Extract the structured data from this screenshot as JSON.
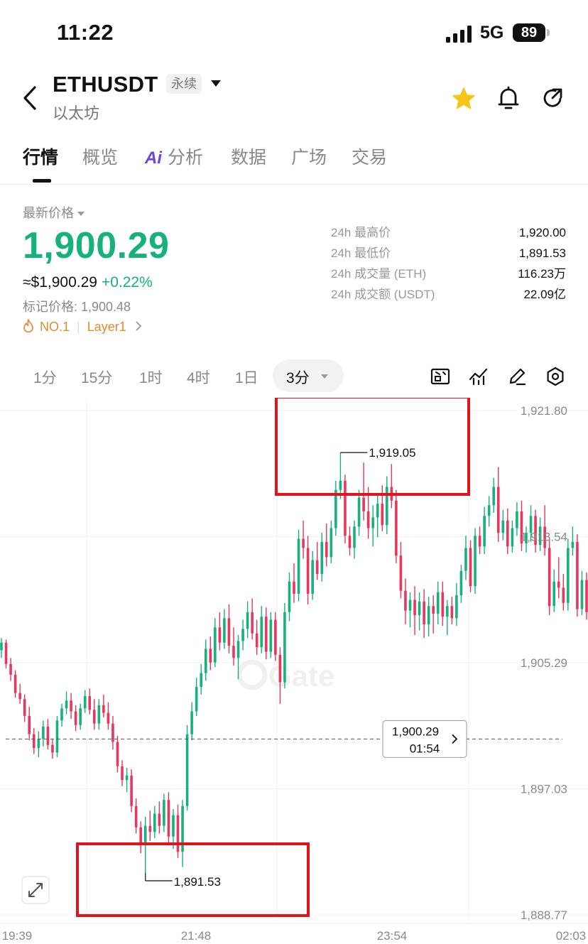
{
  "status_bar": {
    "time": "11:22",
    "network": "5G",
    "battery": "89"
  },
  "header": {
    "symbol": "ETHUSDT",
    "contract_type": "永续",
    "subtitle": "以太坊",
    "icons": [
      "back-icon",
      "star-icon",
      "bell-icon",
      "share-icon"
    ],
    "star_color": "#f5c518"
  },
  "tabs": [
    {
      "label": "行情",
      "active": true
    },
    {
      "label": "概览"
    },
    {
      "label": "分析",
      "prefix": "Ai"
    },
    {
      "label": "数据"
    },
    {
      "label": "广场"
    },
    {
      "label": "交易"
    }
  ],
  "price": {
    "latest_label": "最新价格",
    "last": "1,900.29",
    "usd": "≈$1,900.29",
    "change_pct": "+0.22%",
    "mark_price": "标记价格: 1,900.48",
    "rank": "NO.1",
    "sector": "Layer1",
    "up_color": "#16b27a",
    "down_color": "#e8365c"
  },
  "stats": [
    {
      "label": "24h 最高价",
      "value": "1,920.00"
    },
    {
      "label": "24h 最低价",
      "value": "1,891.53"
    },
    {
      "label": "24h 成交量 (ETH)",
      "value": "116.23万"
    },
    {
      "label": "24h 成交额 (USDT)",
      "value": "22.09亿"
    }
  ],
  "intervals": [
    "1分",
    "15分",
    "1时",
    "4时",
    "1日"
  ],
  "selected_interval": "3分",
  "chart_tools": [
    "indicator-icon",
    "compare-icon",
    "draw-icon",
    "settings-icon",
    "expand-icon"
  ],
  "chart_data": {
    "type": "candlestick",
    "watermark": "Gate",
    "y_ticks": [
      "1,921.80",
      "1,913.54",
      "1,905.29",
      "1,897.03",
      "1,888.77"
    ],
    "y_range": [
      1888.77,
      1921.8
    ],
    "x_ticks": [
      "19:39",
      "21:48",
      "23:54",
      "02:03"
    ],
    "high_label": "1,919.05",
    "low_label": "1,891.53",
    "current_price": "1,900.29",
    "current_countdown": "01:54",
    "highlight_color": "#e0141e",
    "candles": [
      [
        1906.1,
        1906.9,
        1905.6,
        1906.6
      ],
      [
        1906.6,
        1906.8,
        1904.9,
        1905.2
      ],
      [
        1905.2,
        1905.6,
        1904.1,
        1904.5
      ],
      [
        1904.5,
        1904.8,
        1903.0,
        1903.3
      ],
      [
        1903.3,
        1903.9,
        1902.6,
        1902.9
      ],
      [
        1902.9,
        1903.2,
        1901.4,
        1901.8
      ],
      [
        1901.8,
        1902.4,
        1900.2,
        1900.6
      ],
      [
        1900.6,
        1901.0,
        1899.3,
        1899.7
      ],
      [
        1899.7,
        1900.8,
        1899.1,
        1900.3
      ],
      [
        1900.3,
        1901.5,
        1899.8,
        1901.1
      ],
      [
        1901.1,
        1901.6,
        1899.6,
        1899.9
      ],
      [
        1899.9,
        1900.3,
        1899.0,
        1899.4
      ],
      [
        1899.4,
        1901.8,
        1899.1,
        1901.5
      ],
      [
        1901.5,
        1902.6,
        1901.1,
        1902.3
      ],
      [
        1902.3,
        1903.4,
        1901.9,
        1902.8
      ],
      [
        1902.8,
        1903.3,
        1901.6,
        1902.1
      ],
      [
        1902.1,
        1902.5,
        1900.8,
        1901.2
      ],
      [
        1901.2,
        1902.6,
        1900.9,
        1902.3
      ],
      [
        1902.3,
        1903.5,
        1902.0,
        1903.1
      ],
      [
        1903.1,
        1903.6,
        1901.9,
        1902.2
      ],
      [
        1902.2,
        1902.9,
        1900.9,
        1901.3
      ],
      [
        1901.3,
        1902.9,
        1900.9,
        1902.5
      ],
      [
        1902.5,
        1903.2,
        1901.7,
        1902.0
      ],
      [
        1902.0,
        1902.7,
        1900.9,
        1901.3
      ],
      [
        1901.3,
        1901.8,
        1899.6,
        1900.1
      ],
      [
        1900.1,
        1900.5,
        1898.1,
        1898.5
      ],
      [
        1898.5,
        1898.9,
        1897.2,
        1897.6
      ],
      [
        1897.6,
        1898.4,
        1896.8,
        1897.9
      ],
      [
        1897.9,
        1898.3,
        1895.5,
        1895.9
      ],
      [
        1895.9,
        1896.4,
        1894.1,
        1894.5
      ],
      [
        1894.5,
        1894.9,
        1892.8,
        1893.4
      ],
      [
        1893.4,
        1895.2,
        1891.53,
        1894.6
      ],
      [
        1894.6,
        1895.6,
        1893.6,
        1894.2
      ],
      [
        1894.2,
        1895.9,
        1893.8,
        1895.4
      ],
      [
        1895.4,
        1896.2,
        1894.1,
        1894.6
      ],
      [
        1894.6,
        1896.7,
        1894.2,
        1896.3
      ],
      [
        1896.3,
        1896.8,
        1893.5,
        1893.9
      ],
      [
        1893.9,
        1895.7,
        1893.1,
        1895.3
      ],
      [
        1895.3,
        1896.0,
        1892.5,
        1892.9
      ],
      [
        1892.9,
        1896.3,
        1891.9,
        1895.9
      ],
      [
        1895.9,
        1901.2,
        1895.6,
        1900.6
      ],
      [
        1900.6,
        1902.7,
        1900.2,
        1902.1
      ],
      [
        1902.1,
        1904.3,
        1901.8,
        1903.7
      ],
      [
        1903.7,
        1905.2,
        1903.2,
        1904.6
      ],
      [
        1904.6,
        1906.8,
        1904.1,
        1906.2
      ],
      [
        1906.2,
        1907.0,
        1904.8,
        1905.3
      ],
      [
        1905.3,
        1908.2,
        1905.0,
        1907.6
      ],
      [
        1907.6,
        1908.6,
        1906.1,
        1906.6
      ],
      [
        1906.6,
        1908.8,
        1906.2,
        1908.2
      ],
      [
        1908.2,
        1909.1,
        1905.9,
        1906.4
      ],
      [
        1906.4,
        1907.6,
        1905.1,
        1905.6
      ],
      [
        1905.6,
        1907.1,
        1904.2,
        1906.7
      ],
      [
        1906.7,
        1908.1,
        1906.1,
        1907.5
      ],
      [
        1907.5,
        1909.3,
        1906.9,
        1908.6
      ],
      [
        1908.6,
        1909.5,
        1906.8,
        1907.2
      ],
      [
        1907.2,
        1908.1,
        1905.8,
        1906.3
      ],
      [
        1906.3,
        1909.0,
        1905.9,
        1908.3
      ],
      [
        1908.3,
        1908.9,
        1905.5,
        1906.0
      ],
      [
        1906.0,
        1908.6,
        1905.6,
        1908.1
      ],
      [
        1908.1,
        1908.6,
        1905.4,
        1905.8
      ],
      [
        1905.8,
        1906.3,
        1902.6,
        1904.0
      ],
      [
        1904.0,
        1909.2,
        1903.6,
        1908.6
      ],
      [
        1908.6,
        1911.2,
        1908.0,
        1910.6
      ],
      [
        1910.6,
        1911.8,
        1909.2,
        1909.8
      ],
      [
        1909.8,
        1914.0,
        1909.3,
        1913.4
      ],
      [
        1913.4,
        1914.6,
        1912.1,
        1912.8
      ],
      [
        1912.8,
        1913.6,
        1909.1,
        1909.8
      ],
      [
        1909.8,
        1912.6,
        1909.4,
        1912.0
      ],
      [
        1912.0,
        1913.2,
        1910.7,
        1911.1
      ],
      [
        1911.1,
        1913.8,
        1910.6,
        1913.2
      ],
      [
        1913.2,
        1914.4,
        1911.6,
        1912.2
      ],
      [
        1912.2,
        1914.6,
        1911.8,
        1914.1
      ],
      [
        1914.1,
        1917.2,
        1913.6,
        1916.6
      ],
      [
        1916.6,
        1919.05,
        1916.0,
        1917.2
      ],
      [
        1917.2,
        1917.6,
        1913.1,
        1913.6
      ],
      [
        1913.6,
        1914.2,
        1912.3,
        1912.8
      ],
      [
        1912.8,
        1914.6,
        1912.1,
        1914.2
      ],
      [
        1914.2,
        1916.6,
        1913.6,
        1916.1
      ],
      [
        1916.1,
        1918.4,
        1914.6,
        1915.2
      ],
      [
        1915.2,
        1916.8,
        1913.4,
        1914.1
      ],
      [
        1914.1,
        1915.6,
        1912.9,
        1914.8
      ],
      [
        1914.8,
        1916.3,
        1913.5,
        1915.7
      ],
      [
        1915.7,
        1916.9,
        1913.9,
        1914.3
      ],
      [
        1914.3,
        1917.5,
        1913.7,
        1916.8
      ],
      [
        1916.8,
        1918.3,
        1915.4,
        1915.9
      ],
      [
        1915.9,
        1916.6,
        1911.8,
        1912.3
      ],
      [
        1912.3,
        1913.2,
        1909.5,
        1910.0
      ],
      [
        1910.0,
        1910.8,
        1907.8,
        1908.7
      ],
      [
        1908.7,
        1909.9,
        1907.6,
        1909.4
      ],
      [
        1909.4,
        1910.3,
        1907.1,
        1908.4
      ],
      [
        1908.4,
        1909.9,
        1907.4,
        1909.3
      ],
      [
        1909.3,
        1910.1,
        1906.9,
        1907.8
      ],
      [
        1907.8,
        1909.6,
        1907.0,
        1909.0
      ],
      [
        1909.0,
        1909.7,
        1907.2,
        1908.5
      ],
      [
        1908.5,
        1910.6,
        1907.8,
        1909.9
      ],
      [
        1909.9,
        1910.6,
        1907.7,
        1908.3
      ],
      [
        1908.3,
        1909.4,
        1907.1,
        1909.0
      ],
      [
        1909.0,
        1909.6,
        1907.8,
        1908.2
      ],
      [
        1908.2,
        1910.5,
        1907.7,
        1909.7
      ],
      [
        1909.7,
        1911.7,
        1909.2,
        1911.3
      ],
      [
        1911.3,
        1913.6,
        1910.7,
        1912.8
      ],
      [
        1912.8,
        1913.3,
        1909.9,
        1910.3
      ],
      [
        1910.3,
        1914.1,
        1909.8,
        1913.6
      ],
      [
        1913.6,
        1914.2,
        1912.4,
        1912.9
      ],
      [
        1912.9,
        1915.5,
        1912.4,
        1914.9
      ],
      [
        1914.9,
        1916.2,
        1914.2,
        1915.6
      ],
      [
        1915.6,
        1917.4,
        1915.1,
        1916.8
      ],
      [
        1916.8,
        1918.1,
        1913.2,
        1913.8
      ],
      [
        1913.8,
        1915.3,
        1913.3,
        1914.6
      ],
      [
        1914.6,
        1915.4,
        1912.4,
        1912.9
      ],
      [
        1912.9,
        1914.6,
        1912.5,
        1914.1
      ],
      [
        1914.1,
        1915.8,
        1913.6,
        1915.2
      ],
      [
        1915.2,
        1915.9,
        1912.6,
        1913.1
      ],
      [
        1913.1,
        1914.2,
        1912.5,
        1913.8
      ],
      [
        1913.8,
        1915.6,
        1913.2,
        1914.9
      ],
      [
        1914.9,
        1915.3,
        1912.5,
        1913.0
      ],
      [
        1913.0,
        1914.8,
        1912.6,
        1914.2
      ],
      [
        1914.2,
        1915.6,
        1912.3,
        1912.8
      ],
      [
        1912.8,
        1913.5,
        1908.4,
        1909.0
      ],
      [
        1909.0,
        1911.4,
        1908.6,
        1910.6
      ],
      [
        1910.6,
        1912.2,
        1909.5,
        1910.2
      ],
      [
        1910.2,
        1911.1,
        1908.7,
        1909.2
      ],
      [
        1909.2,
        1913.4,
        1908.7,
        1912.8
      ],
      [
        1912.8,
        1914.2,
        1912.3,
        1913.2
      ],
      [
        1913.2,
        1913.7,
        1908.3,
        1908.8
      ],
      [
        1908.8,
        1911.3,
        1908.4,
        1910.7
      ],
      [
        1910.7,
        1911.2,
        1908.1,
        1908.6
      ]
    ]
  }
}
